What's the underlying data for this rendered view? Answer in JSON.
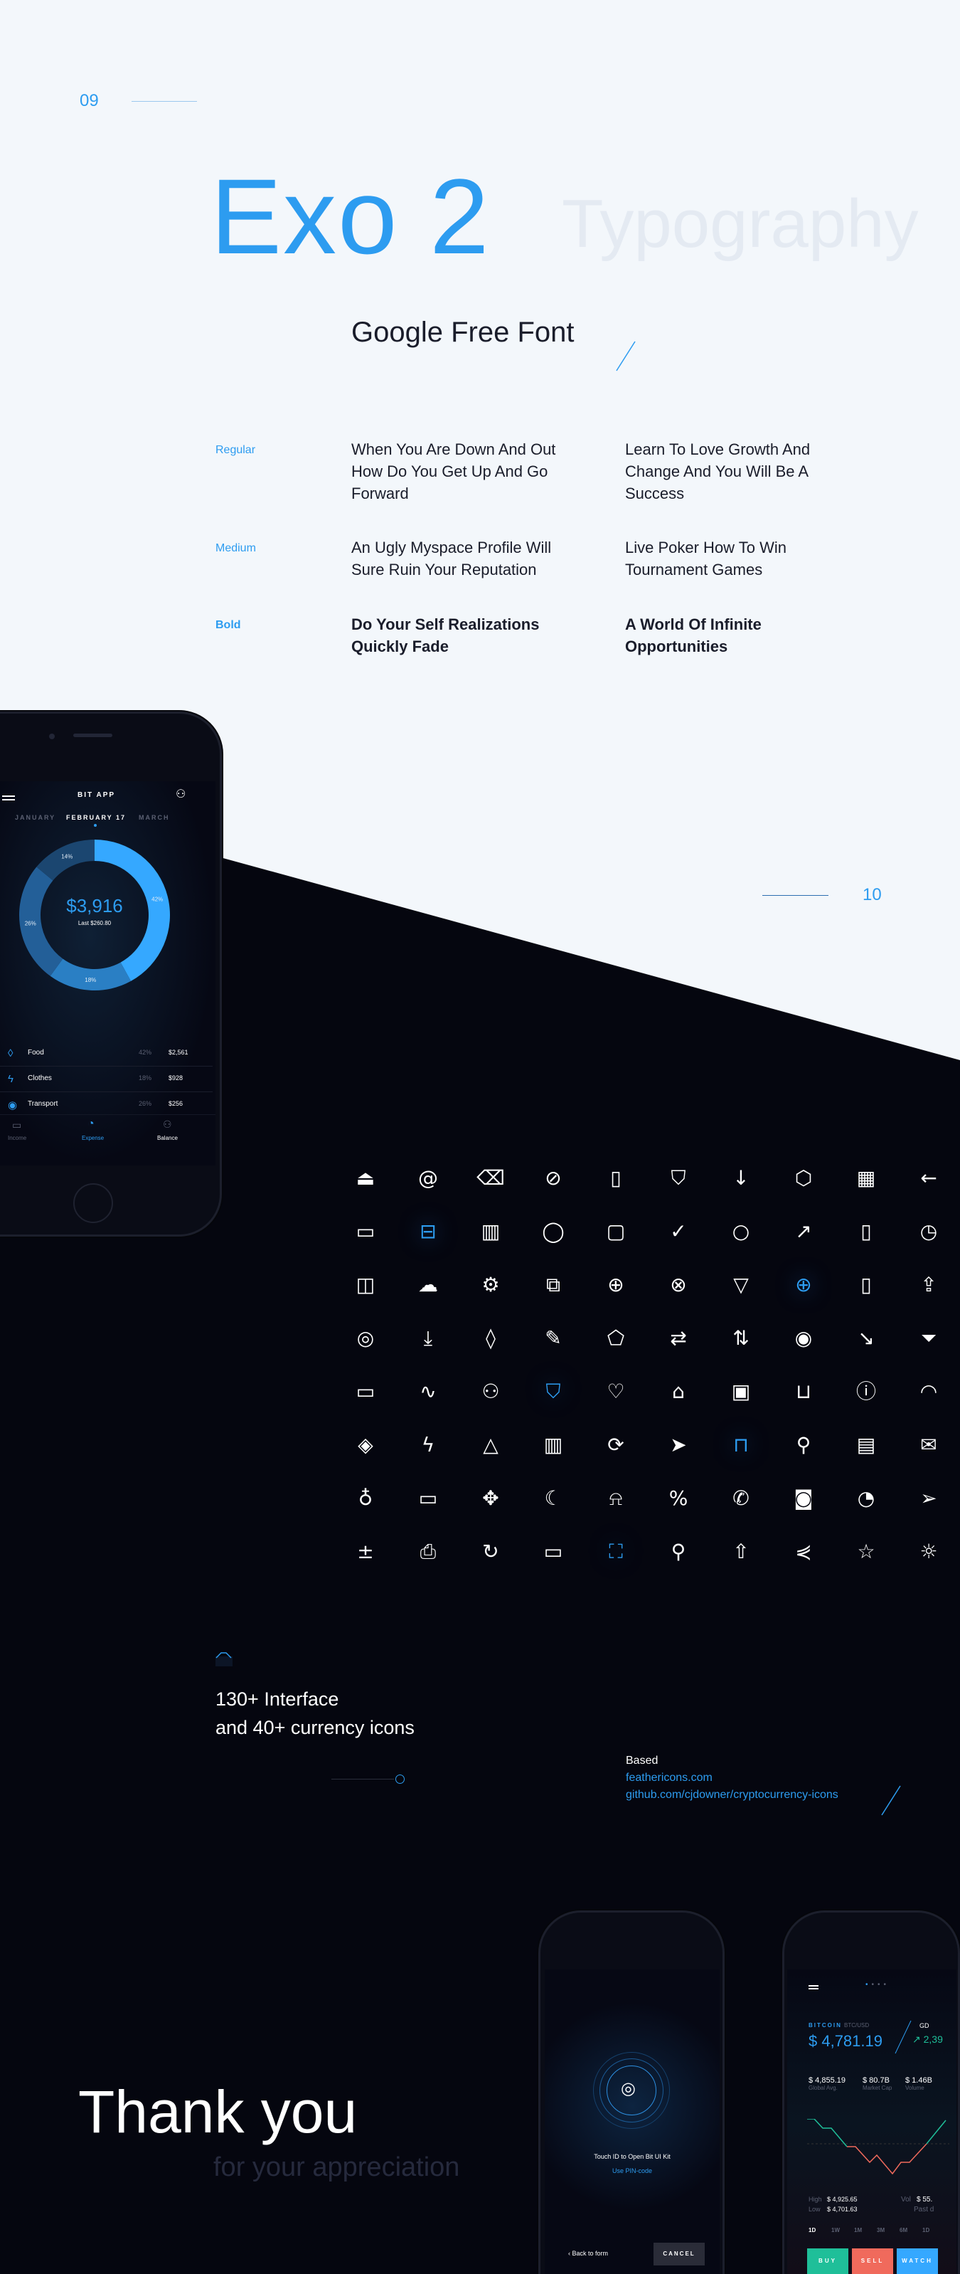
{
  "section1": {
    "number": "09",
    "title": "Exo 2",
    "ghost_title": "Typography",
    "subtitle": "Google Free Font",
    "rows": [
      {
        "label": "Regular",
        "col1": "When You Are Down And Out How Do You Get Up And Go Forward",
        "col2": "Learn To Love Growth And Change And You Will Be A Success"
      },
      {
        "label": "Medium",
        "col1": "An Ugly Myspace Profile Will Sure Ruin Your Reputation",
        "col2": "Live Poker How To Win Tournament Games"
      },
      {
        "label": "Bold",
        "col1": "Do Your Self Realizations Quickly Fade",
        "col2": "A World Of Infinite Opportunities"
      }
    ]
  },
  "section2": {
    "number": "10"
  },
  "phone_expense": {
    "app_title": "BIT APP",
    "months": [
      "JANUARY",
      "FEBRUARY 17",
      "MARCH"
    ],
    "total": "$3,916",
    "last": "Last $260.80",
    "donut": [
      {
        "pct": "42%",
        "value": 42,
        "color": "#35a8ff"
      },
      {
        "pct": "18%",
        "value": 18,
        "color": "#2a7fc4"
      },
      {
        "pct": "26%",
        "value": 26,
        "color": "#235f98"
      },
      {
        "pct": "14%",
        "value": 14,
        "color": "#1b4670"
      }
    ],
    "items": [
      {
        "name": "Food",
        "pct": "42%",
        "amount": "$2,561",
        "icon": "droplet"
      },
      {
        "name": "Clothes",
        "pct": "18%",
        "amount": "$928",
        "icon": "zap"
      },
      {
        "name": "Transport",
        "pct": "26%",
        "amount": "$256",
        "icon": "map-pin"
      }
    ],
    "nav": [
      {
        "label": "Income",
        "active": false
      },
      {
        "label": "Expense",
        "active": true
      },
      {
        "label": "Balance",
        "active": false
      }
    ]
  },
  "icons": [
    [
      "airplay",
      "@",
      "delete",
      "slash",
      "book",
      "bookmark",
      "arrow-down",
      "box",
      "calendar",
      "arrow-left"
    ],
    [
      "credit-card",
      "briefcase",
      "bar-chart",
      "message-circle",
      "message-square",
      "check",
      "circle",
      "trending-up",
      "clipboard",
      "clock"
    ],
    [
      "sidebar",
      "cloud",
      "settings",
      "copy",
      "crosshair",
      "x-circle",
      "thumbs-down",
      "globe",
      "file",
      "upload"
    ],
    [
      "life-buoy",
      "download",
      "droplet",
      "edit",
      "tag",
      "repeat",
      "arrow-up-down",
      "eye",
      "trending-down",
      "filter"
    ],
    [
      "folder",
      "activity",
      "users",
      "shield",
      "heart",
      "home",
      "image",
      "inbox",
      "info",
      "wifi"
    ],
    [
      "layers",
      "zap",
      "thumbs-up",
      "trash",
      "refresh",
      "navigation",
      "lock",
      "map-pin",
      "map",
      "mail"
    ],
    [
      "mic",
      "monitor",
      "move",
      "moon",
      "bell",
      "percent",
      "phone",
      "camera",
      "pie-chart",
      "send"
    ],
    [
      "plus-minus",
      "printer",
      "rotate-cw",
      "tablet",
      "maximize",
      "search",
      "share",
      "share-2",
      "star",
      "sun"
    ]
  ],
  "highlighted_icons": [
    "briefcase",
    "globe",
    "shield",
    "lock",
    "maximize"
  ],
  "icons_text": {
    "line1": "130+ Interface",
    "line2": "and 40+ currency icons",
    "based": "Based",
    "link1": "feathericons.com",
    "link2": "github.com/cjdowner/cryptocurrency-icons"
  },
  "thanks": {
    "title": "Thank you",
    "subtitle": "for your appreciation"
  },
  "phone_touch": {
    "prompt": "Touch ID to Open Bit UI Kit",
    "pin": "Use PIN-code",
    "back": "Back to form",
    "cancel": "CANCEL"
  },
  "phone_bitcoin": {
    "coin": "BITCOIN",
    "pair": "BTC/USD",
    "price": "$ 4,781.19",
    "other": "GD",
    "change": "2,39",
    "stats": [
      {
        "value": "$ 4,855.19",
        "label": "Global Avg."
      },
      {
        "value": "$ 80.7B",
        "label": "Market Cap"
      },
      {
        "value": "$ 1.46B",
        "label": "Volume"
      }
    ],
    "high_label": "High",
    "high": "$ 4,925.65",
    "low_label": "Low",
    "low": "$ 4,701.63",
    "vol_label": "Vol",
    "vol": "$ 55.",
    "past": "Past d",
    "ranges": [
      "1D",
      "1W",
      "1M",
      "3M",
      "6M",
      "1D"
    ],
    "buy": "BUY",
    "sell": "SELL",
    "watch": "WATCH",
    "colors": {
      "up": "#1fbf99",
      "down": "#f06a5c",
      "accent": "#2d9cf0"
    }
  }
}
